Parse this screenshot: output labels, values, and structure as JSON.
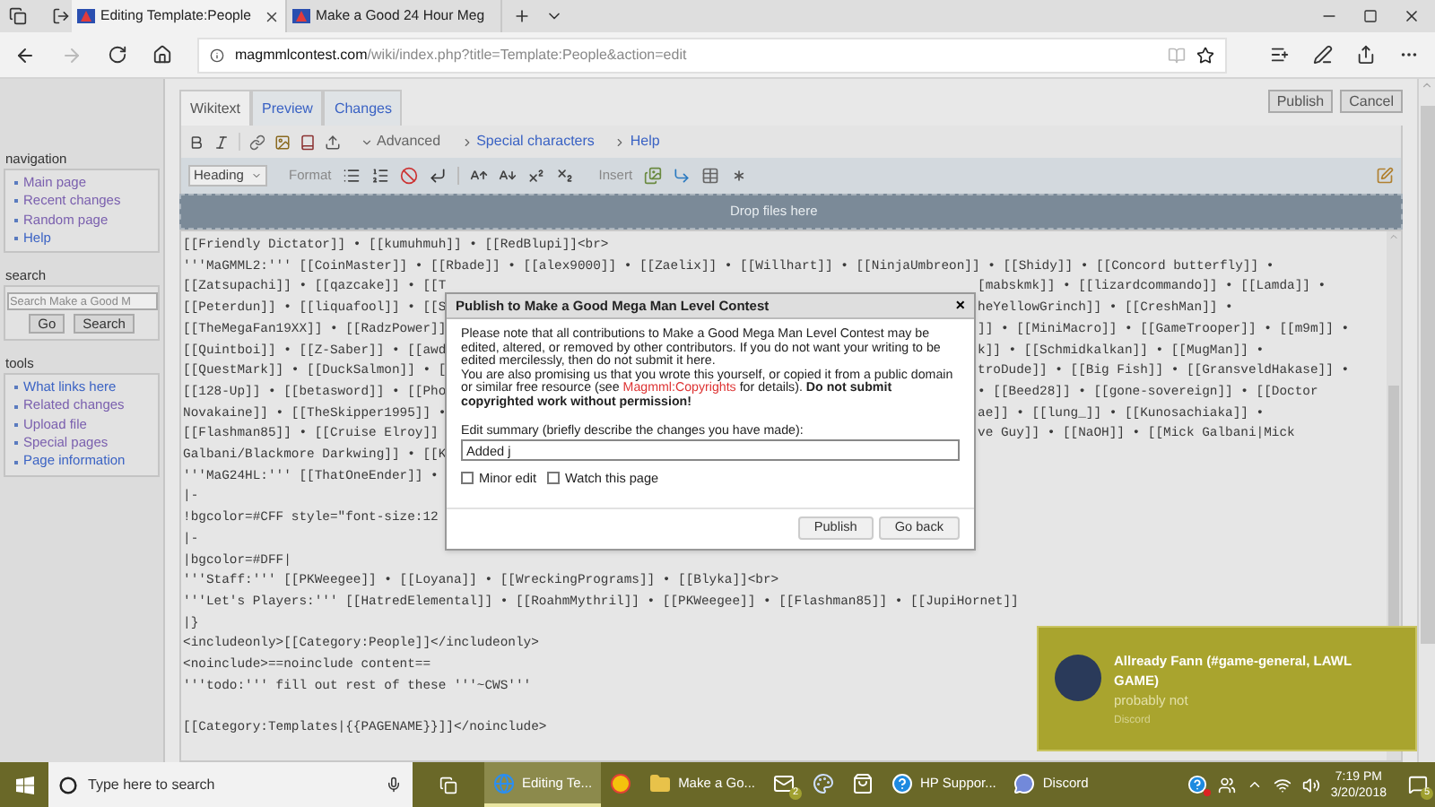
{
  "browser": {
    "tabs": [
      {
        "title": "Editing Template:People",
        "selected": true
      },
      {
        "title": "Make a Good 24 Hour Meg",
        "selected": false
      }
    ],
    "forward_disabled": true,
    "url": {
      "domain": "magmmlcontest.com",
      "path": "/wiki/index.php?title=Template:People&action=edit"
    }
  },
  "sidebar": [
    {
      "kind": "links",
      "heading": "navigation",
      "items": [
        {
          "label": "Main page",
          "visited": true
        },
        {
          "label": "Recent changes",
          "visited": true
        },
        {
          "label": "Random page",
          "visited": true
        },
        {
          "label": "Help",
          "visited": false
        }
      ]
    },
    {
      "kind": "search",
      "heading": "search",
      "placeholder": "Search Make a Good M",
      "buttons": [
        "Go",
        "Search"
      ]
    },
    {
      "kind": "links",
      "heading": "tools",
      "items": [
        {
          "label": "What links here",
          "visited": false
        },
        {
          "label": "Related changes",
          "visited": true
        },
        {
          "label": "Upload file",
          "visited": true
        },
        {
          "label": "Special pages",
          "visited": true
        },
        {
          "label": "Page information",
          "visited": false
        }
      ]
    }
  ],
  "page_actions": [
    "Publish",
    "Cancel"
  ],
  "editor": {
    "tabs": [
      {
        "label": "Wikitext",
        "selected": true
      },
      {
        "label": "Preview",
        "selected": false
      },
      {
        "label": "Changes",
        "selected": false
      }
    ],
    "menus": [
      {
        "label": "Advanced",
        "expanded": true
      },
      {
        "label": "Special characters",
        "expanded": false
      },
      {
        "label": "Help",
        "expanded": false
      }
    ],
    "heading_select": "Heading",
    "format_label": "Format",
    "insert_label": "Insert",
    "drop_zone": "Drop files here",
    "lines": [
      {
        "text": "[[Friendly Dictator]] • [[kumuhmuh]] • [[RedBlupi]]<br>"
      },
      {
        "text": "'''MaGMML2:''' [[CoinMaster]] • [[Rbade]] • [[alex9000]] • [[Zaelix]] • [[Willhart]] • [[NinjaUmbreon]] • [[Shidy]] • [[Concord butterfly]] •"
      },
      {
        "left": "[[Zatsupachi]] • [[qazcake]] • [[T",
        "right": "[mabskmk]] • [[lizardcommando]] • [[Lamda]] •"
      },
      {
        "left": "[[Peterdun]] • [[liquafool]] • [[S",
        "right": "heYellowGrinch]] • [[CreshMan]] •"
      },
      {
        "left": "[[TheMegaFan19XX]] • [[RadzPower]]",
        "right": "]] • [[MiniMacro]] • [[GameTrooper]] • [[m9m]] •"
      },
      {
        "left": "[[Quintboi]] • [[Z-Saber]] • [[awd",
        "right": "k]] • [[Schmidkalkan]] • [[MugMan]] •"
      },
      {
        "left": "[[QuestMark]] • [[DuckSalmon]] • [",
        "right": "troDude]] • [[Big Fish]] • [[GransveldHakase]] •"
      },
      {
        "left": "[[128-Up]] • [[betasword]] • [[Pho",
        "right": "• [[Beed28]] • [[gone-sovereign]] • [[Doctor"
      },
      {
        "left": "Novakaine]] • [[TheSkipper1995]] •",
        "right": "ae]] • [[lung_]] • [[Kunosachiaka]] •"
      },
      {
        "left": "[[Flashman85]] • [[Cruise Elroy]]",
        "right": "ve Guy]] • [[NaOH]] • [[Mick Galbani|Mick"
      },
      {
        "left": "Galbani/Blackmore Darkwing]] • [[K"
      },
      {
        "left": "'''MaG24HL:''' [[ThatOneEnder]] •"
      },
      {
        "text": "|-"
      },
      {
        "left": "!bgcolor=#CFF style=\"font-size:12"
      },
      {
        "text": "|-"
      },
      {
        "text": "|bgcolor=#DFF|"
      },
      {
        "text": "'''Staff:''' [[PKWeegee]] • [[Loyana]] • [[WreckingPrograms]] • [[Blyka]]<br>"
      },
      {
        "text": "'''Let's Players:''' [[HatredElemental]] • [[RoahmMythril]] • [[PKWeegee]] • [[Flashman85]] • [[JupiHornet]]"
      },
      {
        "text": "|}"
      },
      {
        "text": "<includeonly>[[Category:People]]</includeonly>"
      },
      {
        "text": "<noinclude>==noinclude content=="
      },
      {
        "text": "'''todo:''' fill out rest of these '''~CWS'''"
      },
      {
        "blank": true
      },
      {
        "text": "[[Category:Templates|{{PAGENAME}}]]</noinclude>"
      }
    ]
  },
  "dialog": {
    "title": "Publish to Make a Good Mega Man Level Contest",
    "close": "×",
    "notice": "Please note that all contributions to Make a Good Mega Man Level Contest may be edited, altered, or removed by other contributors. If you do not want your writing to be edited mercilessly, then do not submit it here.",
    "promise_before": "You are also promising us that you wrote this yourself, or copied it from a public domain or similar free resource (see ",
    "promise_link": "Magmml:Copyrights",
    "promise_after": " for details). **Do not submit copyrighted work without permission!**",
    "summary_label": "Edit summary (briefly describe the changes you have made):",
    "summary_value": "Added j",
    "checkboxes": [
      {
        "label": "Minor edit",
        "checked": false
      },
      {
        "label": "Watch this page",
        "checked": false
      }
    ],
    "buttons": [
      "Publish",
      "Go back"
    ]
  },
  "notification": {
    "title": "Allready Fann (#game-general, LAWL GAME)",
    "message": "probably not",
    "source": "Discord"
  },
  "taskbar": {
    "search_placeholder": "Type here to search",
    "items": [
      {
        "kind": "edge",
        "label": "Editing Te...",
        "active": true
      },
      {
        "kind": "chrome",
        "active": false
      },
      {
        "kind": "folder",
        "label": "Make a Go...",
        "active": false
      },
      {
        "kind": "mail",
        "badge": "2",
        "active": false
      },
      {
        "kind": "paint",
        "active": false
      },
      {
        "kind": "store",
        "active": false
      },
      {
        "kind": "help",
        "label": "HP Suppor...",
        "active": false
      },
      {
        "kind": "discord",
        "label": "Discord",
        "active": false
      }
    ],
    "time": "7:19 PM",
    "date": "3/20/2018",
    "notification_count": "5"
  }
}
